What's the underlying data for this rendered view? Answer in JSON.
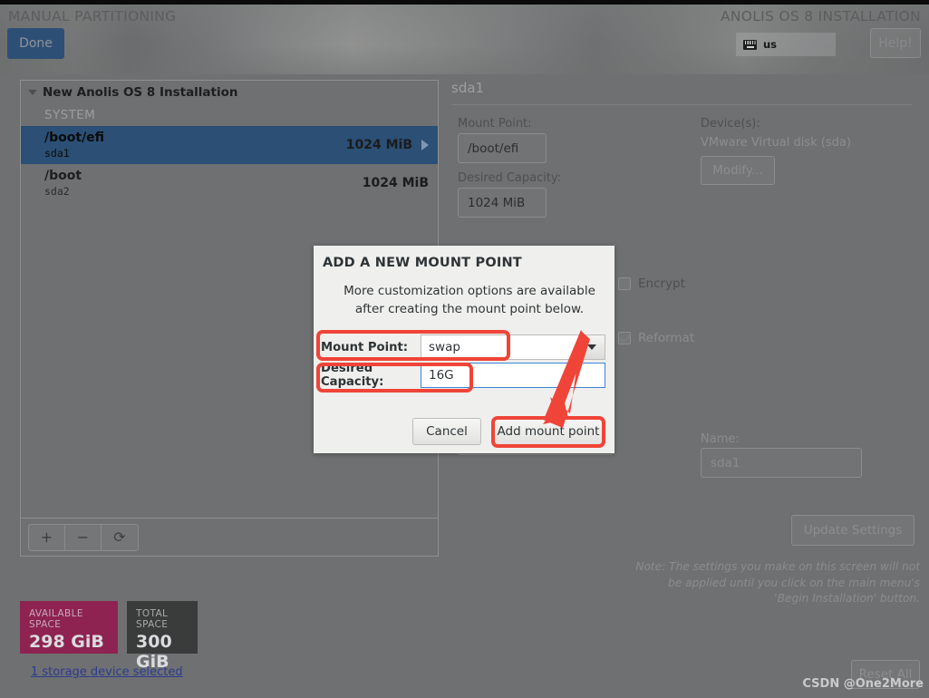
{
  "header": {
    "screen_title": "MANUAL PARTITIONING",
    "product_title": "ANOLIS OS 8 INSTALLATION",
    "done_label": "Done",
    "help_label": "Help!",
    "keyboard_layout": "us",
    "keyboard_icon": "keyboard-icon"
  },
  "left_panel": {
    "tree_root": "New Anolis OS 8 Installation",
    "group_label": "SYSTEM",
    "partitions": [
      {
        "mount": "/boot/efi",
        "device": "sda1",
        "size": "1024 MiB",
        "selected": true
      },
      {
        "mount": "/boot",
        "device": "sda2",
        "size": "1024 MiB",
        "selected": false
      }
    ],
    "toolbar": {
      "add_label": "+",
      "remove_label": "−",
      "refresh_label": "⟳"
    },
    "available_space_caption": "AVAILABLE SPACE",
    "available_space_value": "298 GiB",
    "total_space_caption": "TOTAL SPACE",
    "total_space_value": "300 GiB",
    "storage_link": "1 storage device selected"
  },
  "right_panel": {
    "title": "sda1",
    "mount_point_label": "Mount Point:",
    "mount_point_value": "/boot/efi",
    "desired_capacity_label": "Desired Capacity:",
    "desired_capacity_value": "1024 MiB",
    "devices_label": "Device(s):",
    "devices_value": "VMware Virtual disk  (sda)",
    "modify_label": "Modify...",
    "encrypt_label": "Encrypt",
    "encrypt_checked": false,
    "reformat_label": "Reformat",
    "reformat_checked": true,
    "name_label": "Name:",
    "name_value": "sda1",
    "update_settings_label": "Update Settings",
    "note": "Note:  The settings you make on this screen will not be applied until you click on the main menu's 'Begin Installation' button.",
    "reset_all_label": "Reset All"
  },
  "dialog": {
    "title": "ADD A NEW MOUNT POINT",
    "subtitle": "More customization options are available after creating the mount point below.",
    "mount_point_label": "Mount Point:",
    "mount_point_value": "swap",
    "dropdown_icon": "chevron-down-icon",
    "desired_capacity_label": "Desired Capacity:",
    "desired_capacity_value": "16G",
    "cancel_label": "Cancel",
    "add_label": "Add mount point"
  },
  "annotations": {
    "highlight_color": "#f04438",
    "arrow_icon": "arrow-down-left-icon",
    "watermark": "CSDN @One2More"
  },
  "colors": {
    "accent_blue": "#2b4f75",
    "available_space": "#8e2352",
    "total_space": "#3a3b3b",
    "link": "#2b3c8e",
    "annotation_red": "#f04438"
  }
}
